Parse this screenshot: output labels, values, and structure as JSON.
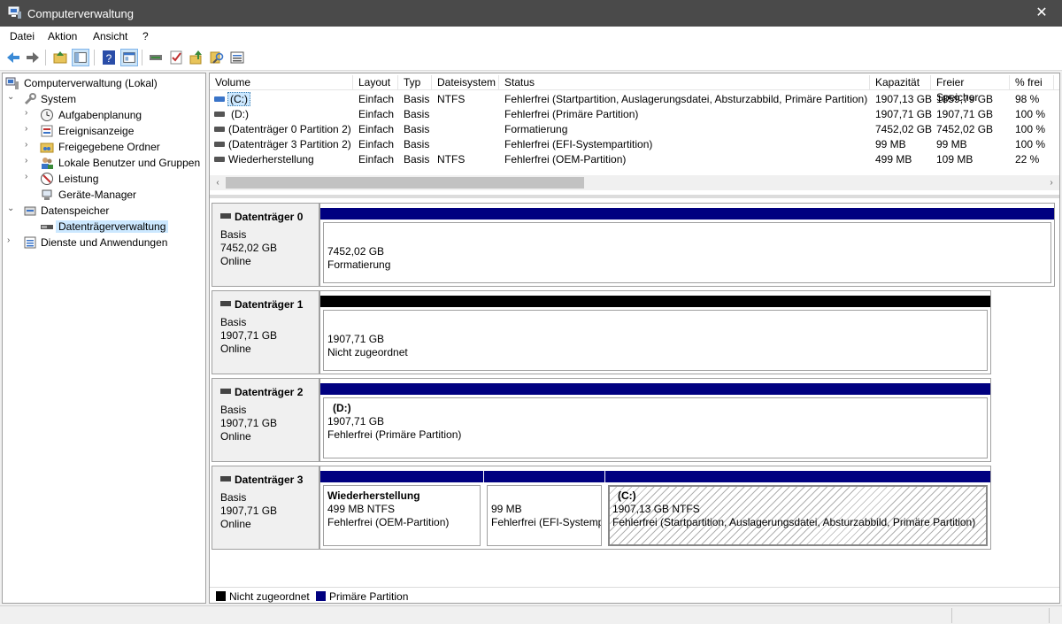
{
  "window": {
    "title": "Computerverwaltung",
    "close_glyph": "✕"
  },
  "menu": {
    "items": [
      "Datei",
      "Aktion",
      "Ansicht",
      "?"
    ]
  },
  "toolbar": {
    "buttons": [
      "back-icon",
      "forward-icon",
      "up-folder-icon",
      "show-hide-tree-icon",
      "help-icon",
      "properties-icon",
      "connect-icon",
      "check-icon",
      "export-icon",
      "search-icon",
      "list-icon"
    ]
  },
  "tree": {
    "root": "Computerverwaltung (Lokal)",
    "system": "System",
    "system_items": [
      "Aufgabenplanung",
      "Ereignisanzeige",
      "Freigegebene Ordner",
      "Lokale Benutzer und Gruppen",
      "Leistung",
      "Geräte-Manager"
    ],
    "storage": "Datenspeicher",
    "storage_items": [
      "Datenträgerverwaltung"
    ],
    "services": "Dienste und Anwendungen"
  },
  "volume_list": {
    "columns": [
      "Volume",
      "Layout",
      "Typ",
      "Dateisystem",
      "Status",
      "Kapazität",
      "Freier Speicher",
      "% frei"
    ],
    "rows": [
      {
        "volume": "(C:)",
        "layout": "Einfach",
        "typ": "Basis",
        "fs": "NTFS",
        "status": "Fehlerfrei (Startpartition, Auslagerungsdatei, Absturzabbild, Primäre Partition)",
        "capacity": "1907,13 GB",
        "free": "1859,79 GB",
        "pct": "98 %",
        "selected": true
      },
      {
        "volume": "(D:)",
        "layout": "Einfach",
        "typ": "Basis",
        "fs": "",
        "status": "Fehlerfrei (Primäre Partition)",
        "capacity": "1907,71 GB",
        "free": "1907,71 GB",
        "pct": "100 %"
      },
      {
        "volume": "(Datenträger 0 Partition 2)",
        "layout": "Einfach",
        "typ": "Basis",
        "fs": "",
        "status": "Formatierung",
        "capacity": "7452,02 GB",
        "free": "7452,02 GB",
        "pct": "100 %"
      },
      {
        "volume": "(Datenträger 3 Partition 2)",
        "layout": "Einfach",
        "typ": "Basis",
        "fs": "",
        "status": "Fehlerfrei (EFI-Systempartition)",
        "capacity": "99 MB",
        "free": "99 MB",
        "pct": "100 %"
      },
      {
        "volume": "Wiederherstellung",
        "layout": "Einfach",
        "typ": "Basis",
        "fs": "NTFS",
        "status": "Fehlerfrei (OEM-Partition)",
        "capacity": "499 MB",
        "free": "109 MB",
        "pct": "22 %"
      }
    ]
  },
  "disks": [
    {
      "name": "Datenträger 0",
      "type": "Basis",
      "size": "7452,02 GB",
      "state": "Online",
      "partitions": [
        {
          "line1": "",
          "line2": "7452,02 GB",
          "line3": "Formatierung"
        }
      ]
    },
    {
      "name": "Datenträger 1",
      "type": "Basis",
      "size": "1907,71 GB",
      "state": "Online",
      "partitions": [
        {
          "line1": "",
          "line2": "1907,71 GB",
          "line3": "Nicht zugeordnet"
        }
      ]
    },
    {
      "name": "Datenträger 2",
      "type": "Basis",
      "size": "1907,71 GB",
      "state": "Online",
      "partitions": [
        {
          "line1": "(D:)",
          "line2": "1907,71 GB",
          "line3": "Fehlerfrei (Primäre Partition)"
        }
      ]
    },
    {
      "name": "Datenträger 3",
      "type": "Basis",
      "size": "1907,71 GB",
      "state": "Online",
      "partitions": [
        {
          "line1": "Wiederherstellung",
          "line2": "499 MB NTFS",
          "line3": "Fehlerfrei (OEM-Partition)"
        },
        {
          "line1": "",
          "line2": "99 MB",
          "line3": "Fehlerfrei (EFI-Systemp"
        },
        {
          "line1": "(C:)",
          "line2": "1907,13 GB NTFS",
          "line3": "Fehlerfrei (Startpartition, Auslagerungsdatei, Absturzabbild, Primäre Partition)"
        }
      ]
    }
  ],
  "legend": {
    "unallocated": "Nicht zugeordnet",
    "primary": "Primäre Partition"
  },
  "colors": {
    "primary": "#000080",
    "unallocated": "#000000",
    "selection": "#cce8ff"
  }
}
